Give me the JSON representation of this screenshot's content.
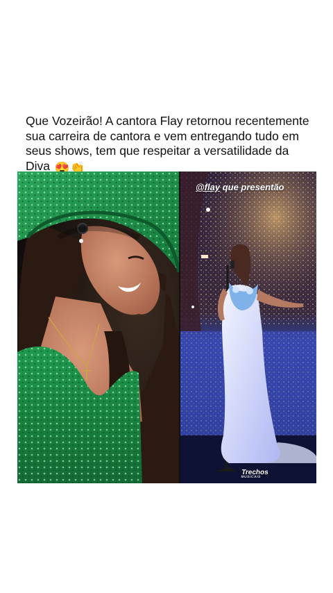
{
  "post": {
    "caption": "Que Vozeirão! A cantora Flay retornou recentemente sua carreira de cantora e vem entregando tudo em seus shows, tem que respeitar a versatilidade da Diva",
    "caption_emojis": "😍👏"
  },
  "images": {
    "left_photo": {
      "description_icon": "photo-image"
    },
    "right_photo": {
      "story_handle": "@flay",
      "story_text": "que presentão",
      "watermark_title": "Trechos",
      "watermark_subtitle": "MUSICAIS"
    }
  },
  "colors": {
    "background": "#ffffff",
    "text": "#111111",
    "hat_green": "#1e8f4a",
    "dress_green": "#1a7a3e",
    "stage_blue": "#3b46a8",
    "gown_white": "#e8ecff"
  }
}
